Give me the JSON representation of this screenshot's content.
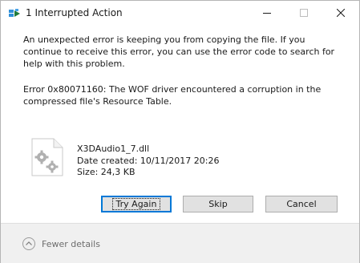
{
  "window": {
    "title": "1 Interrupted Action"
  },
  "dialog": {
    "message": "An unexpected error is keeping you from copying the file. If you continue to receive this error, you can use the error code to search for help with this problem.",
    "error": "Error 0x80071160: The WOF driver encountered a corruption in the compressed file's Resource Table."
  },
  "file": {
    "name": "X3DAudio1_7.dll",
    "date_created": "Date created: 10/11/2017 20:26",
    "size": "Size: 24,3 KB",
    "icon": "dll-file-icon"
  },
  "buttons": {
    "try_again": "Try Again",
    "skip": "Skip",
    "cancel": "Cancel"
  },
  "footer": {
    "details_label": "Fewer details",
    "icon": "chevron-up-icon"
  },
  "colors": {
    "accent": "#0078d7",
    "footer_bg": "#f0f0f0",
    "button_bg": "#e1e1e1"
  }
}
